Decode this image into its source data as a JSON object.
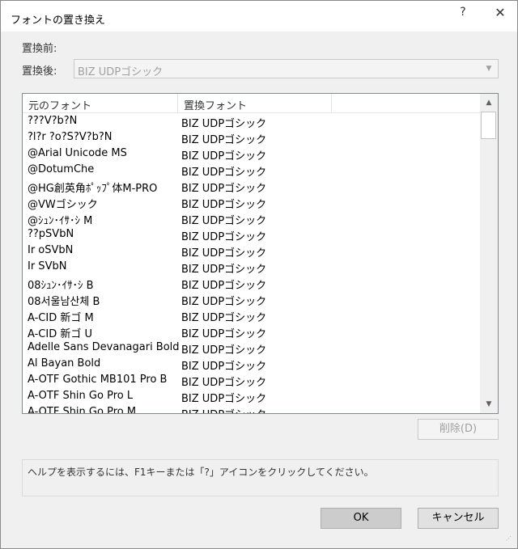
{
  "window": {
    "title": "フォントの置き換え",
    "help_glyph": "?",
    "close_glyph": "✕"
  },
  "form": {
    "before_label": "置換前:",
    "after_label": "置換後:",
    "after_value": "BIZ UDPゴシック"
  },
  "list": {
    "columns": [
      "元のフォント",
      "置換フォント"
    ],
    "rows": [
      [
        "???V?b?N",
        "BIZ UDPゴシック"
      ],
      [
        "?l?r ?o?S?V?b?N",
        "BIZ UDPゴシック"
      ],
      [
        "@Arial Unicode MS",
        "BIZ UDPゴシック"
      ],
      [
        "@DotumChe",
        "BIZ UDPゴシック"
      ],
      [
        "@HG創英角ﾎﾟｯﾌﾟ体M-PRO",
        "BIZ UDPゴシック"
      ],
      [
        "@VWゴシック",
        "BIZ UDPゴシック"
      ],
      [
        "@ｼｭﾝ･ｲｻ･ｼ M",
        "BIZ UDPゴシック"
      ],
      [
        "??pSVbN",
        "BIZ UDPゴシック"
      ],
      [
        "Ir oSVbN",
        "BIZ UDPゴシック"
      ],
      [
        "Ir SVbN",
        "BIZ UDPゴシック"
      ],
      [
        "08ｼｭﾝ･ｲｻ･ｼ B",
        "BIZ UDPゴシック"
      ],
      [
        "08서울남산체 B",
        "BIZ UDPゴシック"
      ],
      [
        "A-CID 新ゴ M",
        "BIZ UDPゴシック"
      ],
      [
        "A-CID 新ゴ U",
        "BIZ UDPゴシック"
      ],
      [
        "Adelle Sans Devanagari Bold",
        "BIZ UDPゴシック"
      ],
      [
        "Al Bayan Bold",
        "BIZ UDPゴシック"
      ],
      [
        "A-OTF Gothic MB101 Pro B",
        "BIZ UDPゴシック"
      ],
      [
        "A-OTF Shin Go Pro L",
        "BIZ UDPゴシック"
      ],
      [
        "A-OTF Shin Go Pro M",
        "BIZ UDPゴシック"
      ]
    ]
  },
  "buttons": {
    "delete": "削除(D)",
    "ok": "OK",
    "cancel": "キャンセル"
  },
  "help_text": "ヘルプを表示するには、F1キーまたは「?」アイコンをクリックしてください。",
  "icons": {
    "scroll_up": "up-arrow-icon",
    "scroll_down": "down-arrow-icon",
    "combo_arrow": "chevron-down-icon",
    "grip": "resize-grip-icon"
  },
  "colors": {
    "dialog_bg": "#f0f0f0",
    "disabled_text": "#a0a0a0",
    "border": "#adadad"
  }
}
